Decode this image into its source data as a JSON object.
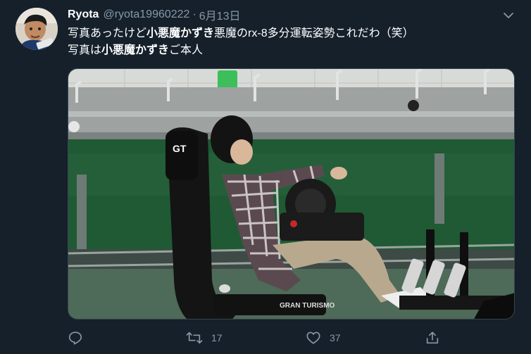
{
  "tweet": {
    "display_name": "Ryota",
    "handle": "@ryota19960222",
    "separator": "·",
    "date": "6月13日",
    "line1": {
      "pre": "写真あったけど",
      "bold": "小悪魔かずき",
      "post": "悪魔のrx-8多分運転姿勢これだわ（笑）"
    },
    "line2": {
      "pre": "写真は",
      "bold": "小悪魔かずき",
      "post": "ご本人"
    }
  },
  "actions": {
    "reply_icon": "reply-icon",
    "retweet_icon": "retweet-icon",
    "retweet_count": "17",
    "like_icon": "heart-icon",
    "like_count": "37",
    "share_icon": "share-icon"
  },
  "colors": {
    "background": "#15202b",
    "secondary_text": "#8899a6",
    "primary_text": "#ffffff"
  }
}
